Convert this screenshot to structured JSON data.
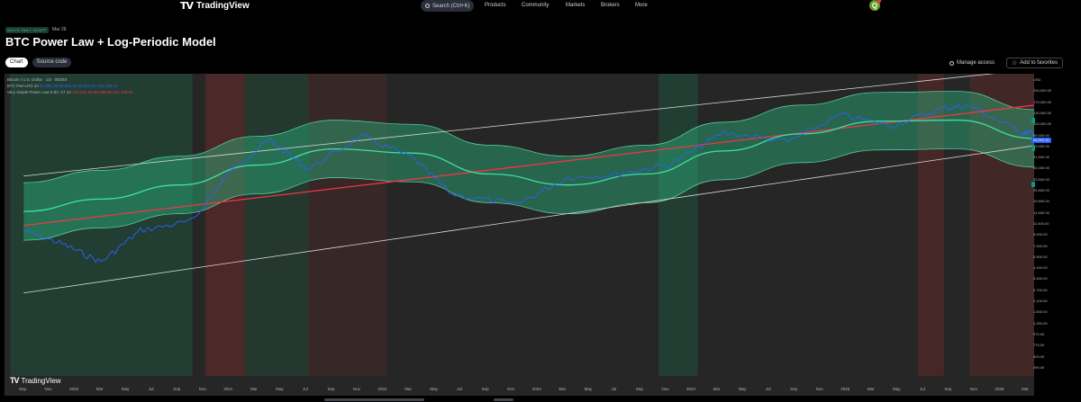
{
  "nav": {
    "logo_text": "TradingView",
    "search_placeholder": "Search (Ctrl+K)",
    "items": [
      "Products",
      "Community",
      "Markets",
      "Brokers",
      "More"
    ],
    "avatar_letter": "Q"
  },
  "script": {
    "badge": "INVITE-ONLY SCRIPT",
    "date": "Mar 26",
    "title": "BTC Power Law + Log-Periodic Model"
  },
  "tabs": [
    {
      "label": "Chart",
      "active": true
    },
    {
      "label": "Source code",
      "active": false
    }
  ],
  "actions": {
    "manage_access": "Manage access",
    "add_favorites": "Add to favorites"
  },
  "legend": [
    {
      "name": "Bitcoin / U.S. Dollar · 1D · INDEX",
      "values": "",
      "color": "blue"
    },
    {
      "name": "BTC Pwr-LPO 10",
      "values": "91,992.38  50,506.93  39,851.44  123,406.21",
      "color": "blue"
    },
    {
      "name": "Very simple Power Law 5.83 -17 10",
      "values": "176,216.59  55,689.96  222,759.84",
      "color": "red"
    }
  ],
  "watermark": "TradingView",
  "x_axis_labels": [
    "Sep",
    "Nov",
    "2020",
    "Mar",
    "May",
    "Jul",
    "Sep",
    "Nov",
    "2021",
    "Mar",
    "May",
    "Jul",
    "Sep",
    "Nov",
    "2022",
    "Mar",
    "May",
    "Jul",
    "Sep",
    "Nov",
    "2023",
    "Mar",
    "May",
    "Jul",
    "Sep",
    "Nov",
    "2024",
    "Mar",
    "May",
    "Jul",
    "Sep",
    "Nov",
    "2025",
    "Mar",
    "May",
    "Jul",
    "Sep",
    "Nov",
    "2026",
    "Mar"
  ],
  "y_axis_labels": [
    "USD",
    "200,000.00",
    "170,000.00",
    "130,000.00",
    "100,000.00",
    "80,000.00",
    "60,000.00",
    "51,500.00",
    "40,000.00",
    "33,500.00",
    "25,500.00",
    "19,500.00",
    "14,500.00",
    "11,500.00",
    "9,000.00",
    "7,000.00",
    "5,500.00",
    "4,400.00",
    "3,400.00",
    "2,700.00",
    "2,100.00",
    "1,600.00",
    "1,250.00",
    "970.00",
    "770.00",
    "600.00",
    "490.00"
  ],
  "price_tags": [
    {
      "label": "",
      "color": "#089981"
    },
    {
      "label": "68,892.81",
      "color": "#2962ff"
    },
    {
      "label": "",
      "color": "#089981"
    },
    {
      "label": "",
      "color": "#089981"
    }
  ],
  "chart_data": {
    "type": "line",
    "scale": "log",
    "grid": false,
    "x_range": [
      "2019-08",
      "2026-03"
    ],
    "y_range": [
      490,
      200000
    ],
    "series": [
      {
        "role": "price",
        "color": "#2962ff",
        "x": [
          "2019-09",
          "2019-12",
          "2020-03",
          "2020-06",
          "2020-10",
          "2021-01",
          "2021-04",
          "2021-07",
          "2021-11",
          "2022-03",
          "2022-06",
          "2022-11",
          "2023-03",
          "2023-07",
          "2023-11",
          "2024-03",
          "2024-08",
          "2024-12",
          "2025-04",
          "2025-08",
          "2025-10",
          "2026-02",
          "2026-03"
        ],
        "y": [
          9500,
          7200,
          5000,
          9500,
          11500,
          33000,
          60000,
          33000,
          65000,
          42000,
          20000,
          16000,
          28000,
          30000,
          37000,
          70000,
          58000,
          100000,
          80000,
          115000,
          120000,
          70000,
          68892
        ]
      },
      {
        "role": "model-center",
        "color": "#3fe0a5",
        "x": [
          "2019-09",
          "2020-03",
          "2020-09",
          "2021-03",
          "2021-09",
          "2022-03",
          "2022-09",
          "2023-03",
          "2023-09",
          "2024-03",
          "2024-09",
          "2025-03",
          "2025-09",
          "2026-03"
        ],
        "y": [
          14000,
          18000,
          24000,
          36000,
          50000,
          46000,
          30000,
          24000,
          30000,
          48000,
          68000,
          88000,
          90000,
          62000
        ]
      },
      {
        "role": "power-law-center",
        "color": "#f23645",
        "x": [
          "2019-09",
          "2026-03"
        ],
        "y": [
          10500,
          122000
        ]
      }
    ],
    "shading": {
      "green": "#1e6e4e",
      "red": "#6e2a2a"
    }
  }
}
